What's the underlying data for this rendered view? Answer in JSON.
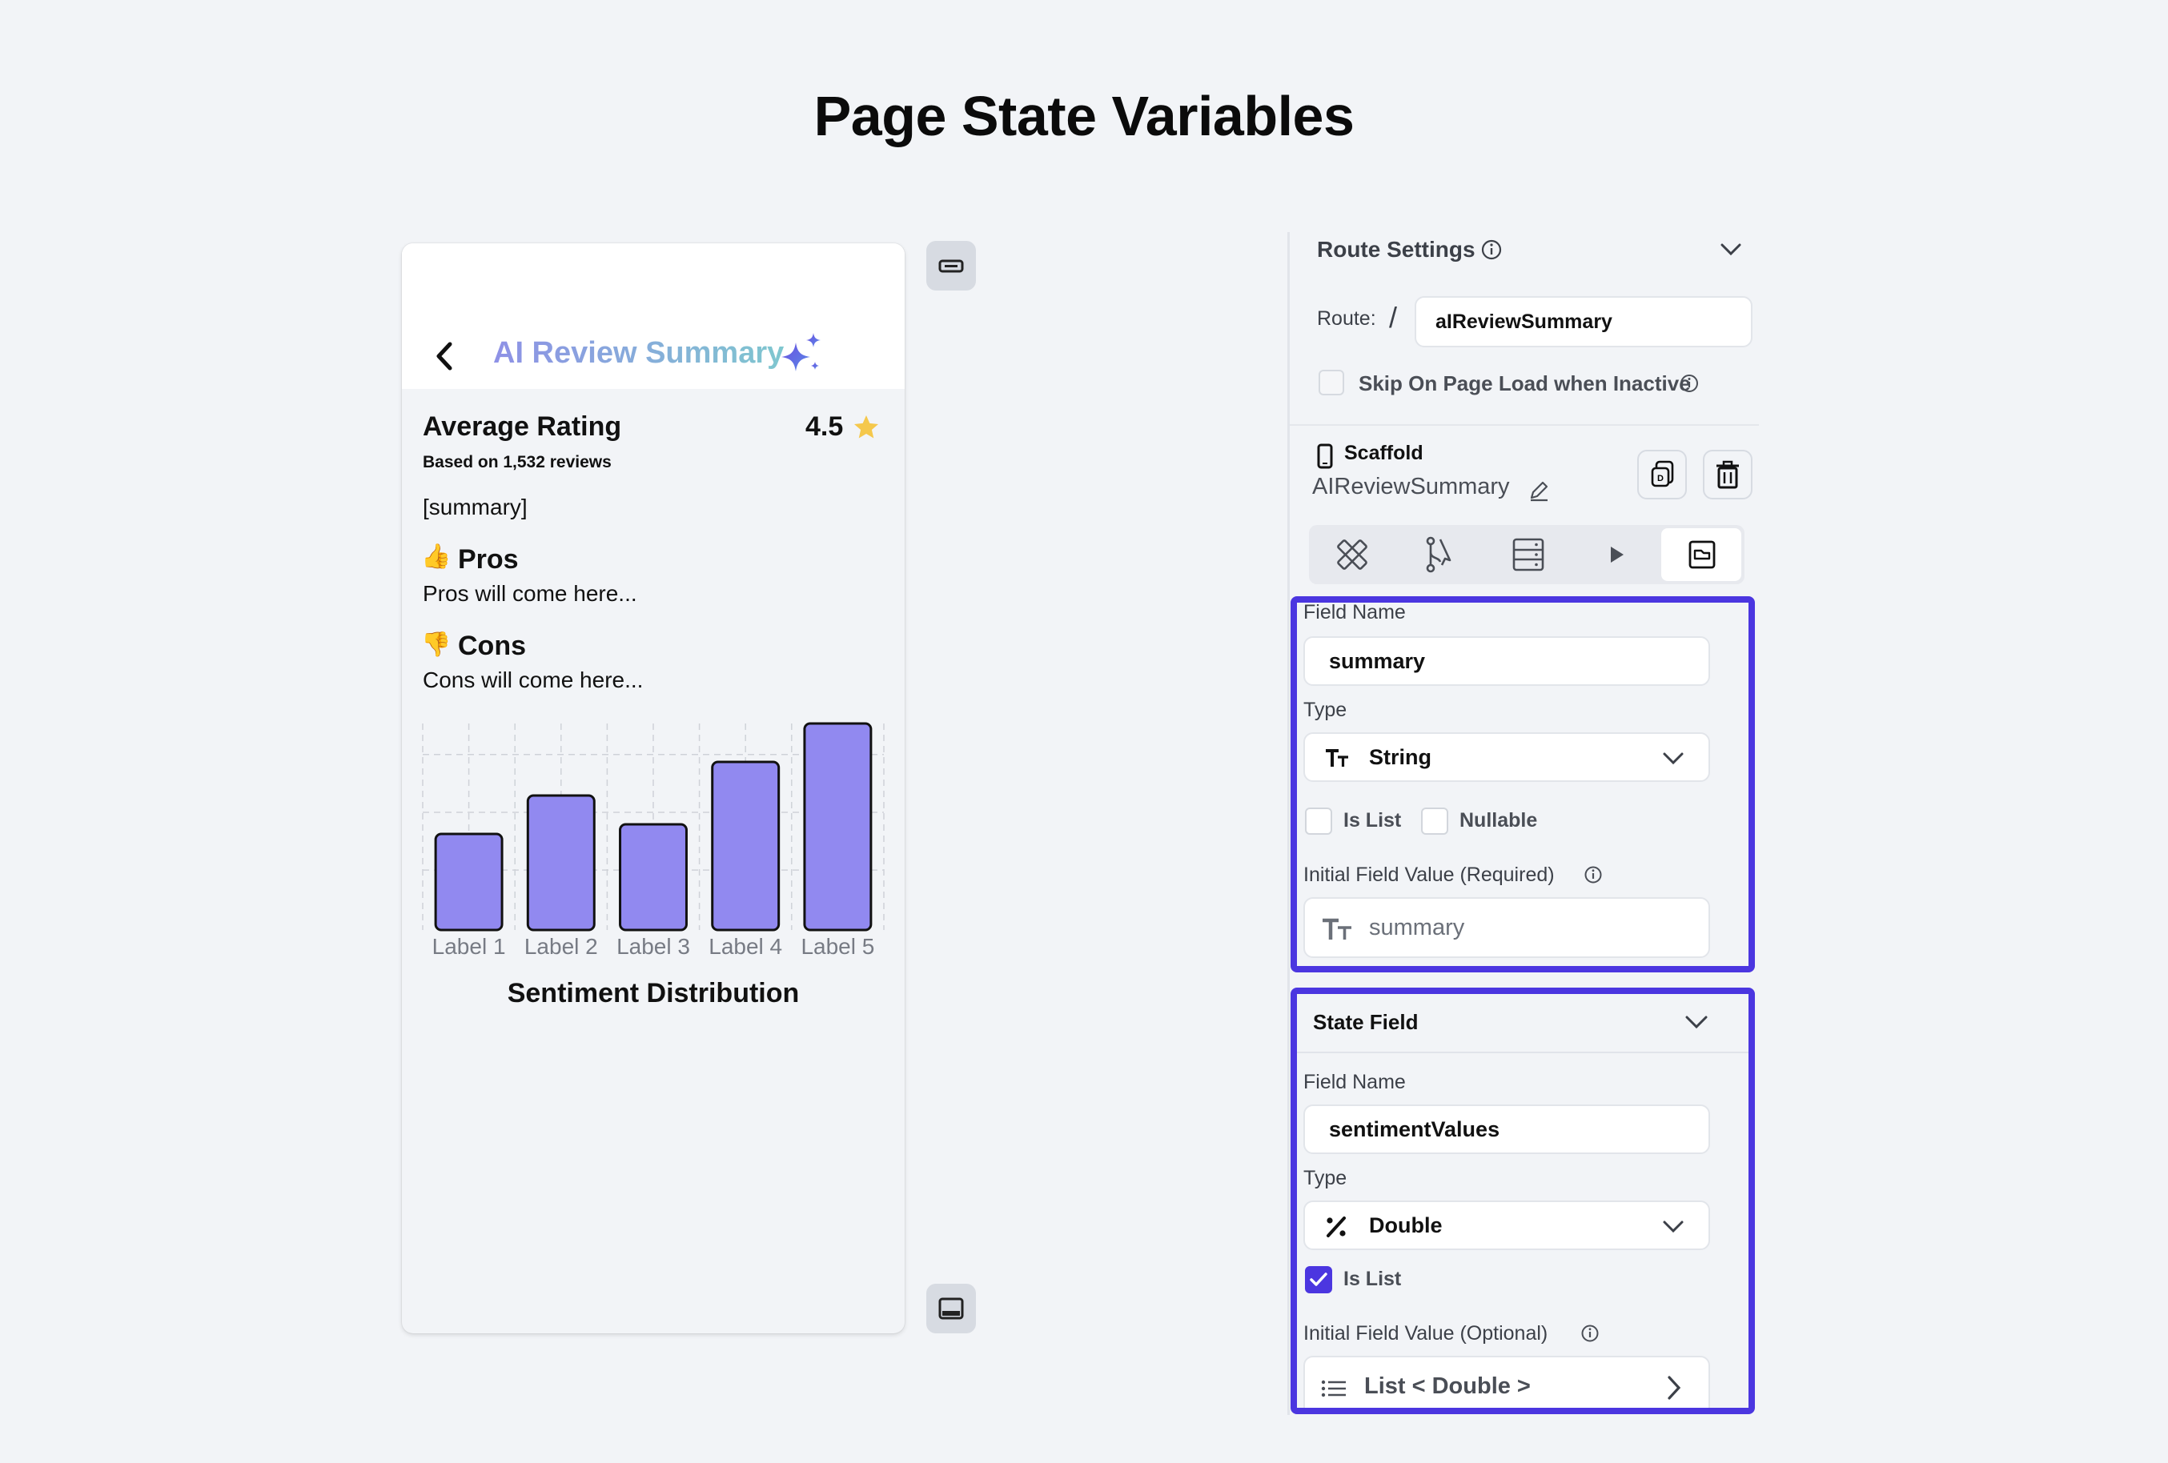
{
  "page": {
    "title": "Page State Variables"
  },
  "preview": {
    "app_bar_title": "AI Review Summary",
    "average_rating_label": "Average Rating",
    "rating_value": "4.5",
    "based_on": "Based on 1,532 reviews",
    "summary_placeholder": "[summary]",
    "pros_emoji": "👍",
    "pros_title": "Pros",
    "pros_text": "Pros will come here...",
    "cons_emoji": "👎",
    "cons_title": "Cons",
    "cons_text": "Cons will come here..."
  },
  "chart_data": {
    "type": "bar",
    "title": "Sentiment Distribution",
    "categories": [
      "Label 1",
      "Label 2",
      "Label 3",
      "Label 4",
      "Label 5"
    ],
    "values": [
      2.0,
      2.8,
      2.2,
      3.5,
      4.3
    ],
    "ylim": [
      0,
      4.3
    ],
    "grid": true,
    "bar_color": "#9189f0"
  },
  "panel": {
    "route_settings_label": "Route Settings",
    "route_label": "Route:",
    "route_slash": "/",
    "route_value": "aIReviewSummary",
    "skip_label": "Skip On Page Load when Inactive",
    "scaffold_label": "Scaffold",
    "page_name": "AIReviewSummary",
    "field1": {
      "field_name_label": "Field Name",
      "field_name_value": "summary",
      "type_label": "Type",
      "type_value": "String",
      "is_list_label": "Is List",
      "nullable_label": "Nullable",
      "initial_label": "Initial Field Value (Required)",
      "initial_value": "summary"
    },
    "field2": {
      "header": "State Field",
      "field_name_label": "Field Name",
      "field_name_value": "sentimentValues",
      "type_label": "Type",
      "type_value": "Double",
      "is_list_label": "Is List",
      "is_list_checked": true,
      "initial_label": "Initial Field Value (Optional)",
      "initial_value": "List < Double >"
    }
  },
  "colors": {
    "accent": "#4b36e0",
    "bar": "#9189f0",
    "star": "#f5c84c"
  }
}
